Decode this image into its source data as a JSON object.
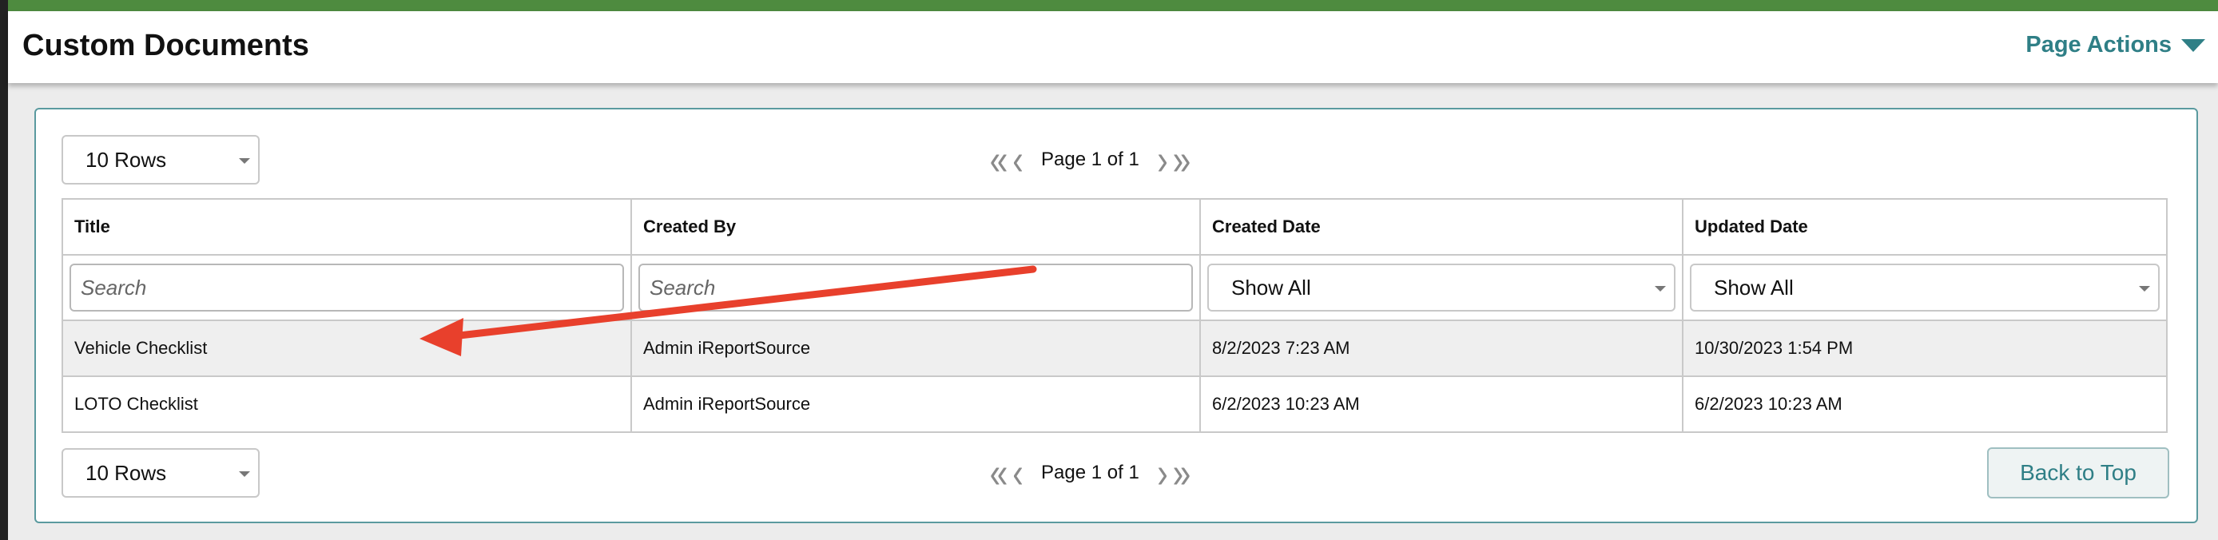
{
  "header": {
    "title": "Custom Documents",
    "page_actions_label": "Page Actions"
  },
  "pagination": {
    "rows_selected": "10 Rows",
    "page_text": "Page 1 of 1"
  },
  "table": {
    "columns": [
      "Title",
      "Created By",
      "Created Date",
      "Updated Date"
    ],
    "filters": {
      "search_placeholder": "Search",
      "date_filter_value": "Show All"
    },
    "rows": [
      {
        "title": "Vehicle Checklist",
        "created_by": "Admin iReportSource",
        "created_date": "8/2/2023 7:23 AM",
        "updated_date": "10/30/2023 1:54 PM"
      },
      {
        "title": "LOTO Checklist",
        "created_by": "Admin iReportSource",
        "created_date": "6/2/2023 10:23 AM",
        "updated_date": "6/2/2023 10:23 AM"
      }
    ]
  },
  "footer": {
    "back_to_top_label": "Back to Top"
  },
  "colors": {
    "brand_green": "#4e8b3f",
    "accent_teal": "#2f7f86",
    "annotation_red": "#e8402c"
  },
  "icons": [
    "chevron-down-icon",
    "first-page-icon",
    "previous-page-icon",
    "next-page-icon",
    "last-page-icon",
    "caret-down-icon",
    "annotation-arrow"
  ]
}
